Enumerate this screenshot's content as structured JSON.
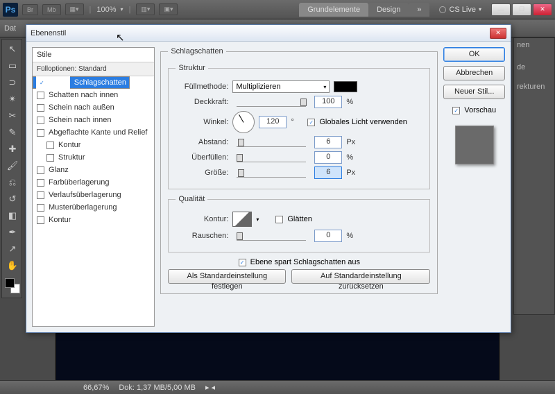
{
  "appbar": {
    "zoom": "100%",
    "ws_active": "Grundelemente",
    "ws_other": "Design",
    "cslive": "CS Live"
  },
  "optbar": {
    "left": "Dat"
  },
  "rpanel": {
    "a": "nen",
    "b": "de",
    "c": "rekturen"
  },
  "status": {
    "zoom": "66,67%",
    "doc": "Dok: 1,37 MB/5,00 MB"
  },
  "dialog": {
    "title": "Ebenenstil",
    "styles_header": "Stile",
    "fill_opts": "Fülloptionen: Standard",
    "items": [
      {
        "label": "Schlagschatten",
        "checked": true,
        "sel": true
      },
      {
        "label": "Schatten nach innen"
      },
      {
        "label": "Schein nach außen"
      },
      {
        "label": "Schein nach innen"
      },
      {
        "label": "Abgeflachte Kante und Relief"
      },
      {
        "label": "Kontur",
        "indent": true
      },
      {
        "label": "Struktur",
        "indent": true
      },
      {
        "label": "Glanz"
      },
      {
        "label": "Farbüberlagerung"
      },
      {
        "label": "Verlaufsüberlagerung"
      },
      {
        "label": "Musterüberlagerung"
      },
      {
        "label": "Kontur"
      }
    ],
    "group_main": "Schlagschatten",
    "group_struct": "Struktur",
    "group_qual": "Qualität",
    "blend_label": "Füllmethode:",
    "blend_value": "Multiplizieren",
    "opacity_label": "Deckkraft:",
    "opacity_value": "100",
    "opacity_unit": "%",
    "angle_label": "Winkel:",
    "angle_value": "120",
    "angle_unit": "°",
    "global_light": "Globales Licht verwenden",
    "distance_label": "Abstand:",
    "distance_value": "6",
    "distance_unit": "Px",
    "spread_label": "Überfüllen:",
    "spread_value": "0",
    "spread_unit": "%",
    "size_label": "Größe:",
    "size_value": "6",
    "size_unit": "Px",
    "contour_label": "Kontur:",
    "antialias": "Glätten",
    "noise_label": "Rauschen:",
    "noise_value": "0",
    "noise_unit": "%",
    "knockout": "Ebene spart Schlagschatten aus",
    "btn_default": "Als Standardeinstellung festlegen",
    "btn_reset": "Auf Standardeinstellung zurücksetzen",
    "ok": "OK",
    "cancel": "Abbrechen",
    "new_style": "Neuer Stil...",
    "preview": "Vorschau"
  }
}
